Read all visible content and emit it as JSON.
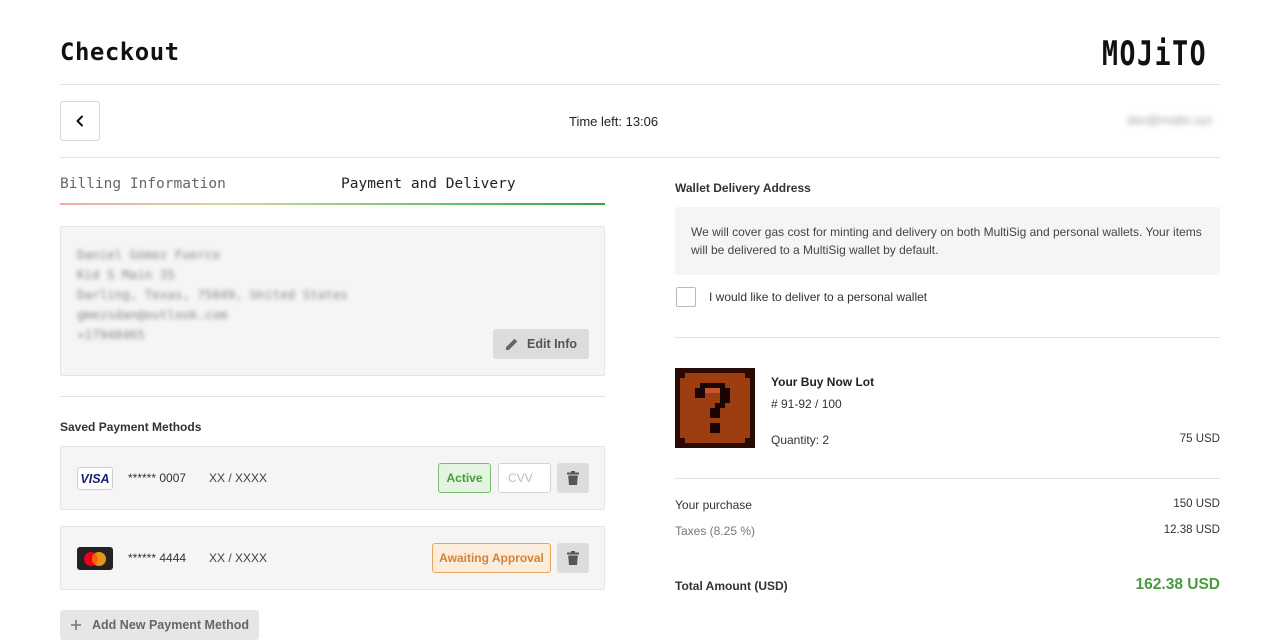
{
  "header": {
    "title": "Checkout",
    "logo": "MOJiTO",
    "timer": "Time left: 13:06",
    "user_email": "dan@mojito.xyz"
  },
  "tabs": [
    {
      "label": "Billing Information",
      "active": false
    },
    {
      "label": "Payment and Delivery",
      "active": true
    }
  ],
  "billing": {
    "lines": [
      "Daniel Gómez Fuerco",
      "Kid S Main 35",
      "Darling, Texas, 75049, United States",
      "gmezsdan@outlook.com",
      "+17948465"
    ],
    "edit_label": "Edit Info"
  },
  "payment": {
    "section_label": "Saved Payment Methods",
    "methods": [
      {
        "brand_icon": "visa-icon",
        "brand_text": "VISA",
        "number": "****** 0007",
        "expiry": "XX / XXXX",
        "status": "Active",
        "status_color": "#4a9a40",
        "cvv_placeholder": "CVV"
      },
      {
        "brand_icon": "mastercard-icon",
        "number": "****** 4444",
        "expiry": "XX / XXXX",
        "status": "Awaiting Approval",
        "status_color": "#d2843a"
      }
    ],
    "add_label": "Add New Payment Method"
  },
  "wallet": {
    "title": "Wallet Delivery Address",
    "note": "We will cover gas cost for minting and delivery on both MultiSig and personal wallets. Your items will be delivered to a MultiSig wallet by default.",
    "checkbox_label": "I would like to deliver to a personal wallet",
    "checkbox_checked": false
  },
  "lot": {
    "title": "Your Buy Now Lot",
    "number": "# 91-92 / 100",
    "quantity": "Quantity: 2",
    "price": "75 USD",
    "image_icon": "question-block-icon"
  },
  "summary": {
    "purchase_label": "Your purchase",
    "purchase_value": "150 USD",
    "taxes_label": "Taxes (8.25 %)",
    "taxes_value": "12.38 USD",
    "total_label": "Total Amount (USD)",
    "total_value": "162.38 USD",
    "accent": "#4a9a40"
  }
}
